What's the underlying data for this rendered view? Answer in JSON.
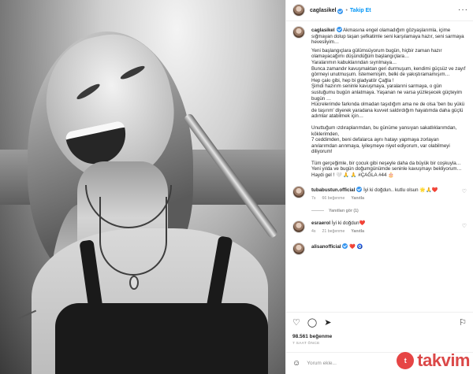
{
  "post": {
    "username": "caglasikel",
    "follow_label": "Takip Et",
    "more_icon": "more-icon",
    "caption_paragraphs": [
      "Akmasına engel olamadığım gözyaşlarımla, içime sığmayan dolup taşan şefkatimle seni karşılamaya hazır, seni sarmaya hevesliyim…",
      "Yeni başlangıçlara gülümsüyorum bugün, hiçbir zaman hazır olamayacağımı düşündüğüm başlangıçlara…\nYaralarımın kabuklarından sıyrılmaya…\nBunca zamandır kavuşmaktan geri durmuşum, kendimi güçsüz ve zayıf görmeyi unutmuşum. İstememişim, belki de yakıştıramamışım…\nHep çakı gibi, hep bi gladyatör Çağla !\nŞimdi hazırım seninle kavuşmaya, yaralarıni sarmaya, o gün sustuğumu bugün anlatmaya. Yaşanan ne varsa yüzleşecek güçteyim bugün …\nHücrelerimde farkında olmadan taşıdığım ama ne de olsa 'ben bu yükü de taşırım' diyerek yaradana kuvvet saldırdığım hayatımda daha güçlü adımlar atabilmek için…",
      "Unuttuğum ızdıraplarımdan, bu günüme yansıyan sakatlıklarımdan, köklerimden,\n7 ceddimden, beni defalarca aynı hatayı yapmaya zorlayan anılarımdan arınmaya, iyileşmeye niyet ediyorum, var olabilmeyi diliyorum!",
      "Tüm gerçeğimle, bir çocuk gibi neşeyle daha da büyük bir coşkuyla…\nYeni yılda ve bugün doğumgünümde seninle kavuşmayı bekliyorum…\nHaydi gel ! 🤍 🙏"
    ],
    "hashtags": [
      "#ÇAĞLA",
      "#44"
    ],
    "comments": [
      {
        "username": "tubabustun.official",
        "text": "İyi ki doğdun.. kutlu olsun 🌟🙏❤️",
        "time": "7s",
        "likes": "66 beğenme",
        "reply_label": "Yanıtla",
        "replies_label": "Yanıtları gör (1)"
      },
      {
        "username": "esraerol",
        "text": "İyi ki doğdun❤️",
        "time": "4s",
        "likes": "21 beğenme",
        "reply_label": "Yanıtla"
      },
      {
        "username": "alisanofficial",
        "text": "❤️ 🧿",
        "time": "",
        "likes": "",
        "reply_label": ""
      }
    ],
    "likes_count": "98.561 beğenme",
    "posted_time": "7 SAAT ÖNCE",
    "comment_placeholder": "Yorum ekle..."
  },
  "icons": {
    "like": "heart-icon",
    "comment": "comment-icon",
    "share": "share-icon",
    "save": "bookmark-icon",
    "emoji": "emoji-icon"
  },
  "watermark": {
    "badge": "t",
    "word": "takvim"
  },
  "colors": {
    "link": "#00376b",
    "follow": "#0095f6",
    "verified": "#3897f0",
    "watermark": "#d93b3b"
  }
}
